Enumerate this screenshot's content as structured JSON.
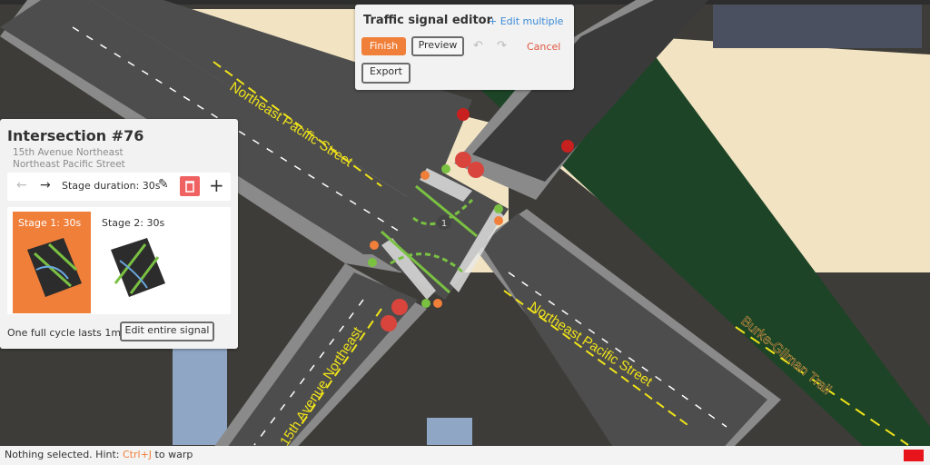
{
  "map": {
    "street_labels": {
      "pacific_upper": "Northeast Pacific Street",
      "pacific_lower": "Northeast Pacific Street",
      "avenue": "15th Avenue Northeast",
      "trail": "Burke-Gilman Trail"
    },
    "intersection_marker": "1",
    "colors": {
      "road": "#4c4c4c",
      "sidewalk": "#7b7b7b",
      "lot": "#f2e4c3",
      "trail": "#1d4426",
      "arrow": "#7ac142",
      "signal_red": "#d9443c"
    }
  },
  "editor": {
    "title": "Traffic signal editor",
    "edit_multiple": "+ Edit multiple",
    "finish": "Finish",
    "preview": "Preview",
    "undo_icon": "undo-icon",
    "redo_icon": "redo-icon",
    "cancel": "Cancel",
    "export": "Export"
  },
  "intersection": {
    "title": "Intersection #76",
    "street1": "15th Avenue Northeast",
    "street2": "Northeast Pacific Street",
    "stage_duration": "Stage duration: 30s",
    "stages": [
      {
        "label": "Stage 1: 30s",
        "selected": true
      },
      {
        "label": "Stage 2: 30s",
        "selected": false
      }
    ],
    "cycle": "One full cycle lasts 1min",
    "edit_entire": "Edit entire signal"
  },
  "status": {
    "prefix": "Nothing selected. Hint: ",
    "key": "Ctrl+J",
    "suffix": " to warp"
  }
}
